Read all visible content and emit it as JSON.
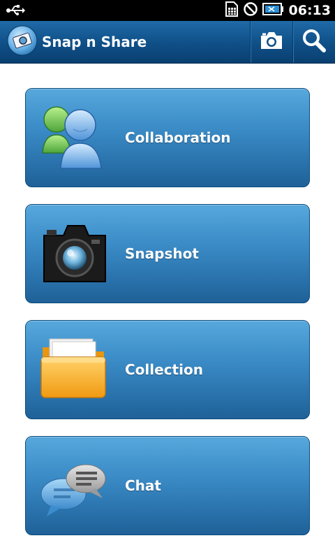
{
  "status_bar": {
    "time": "06:13",
    "icons": [
      "usb-icon",
      "sim-icon",
      "no-sign-icon",
      "battery-icon"
    ]
  },
  "app_bar": {
    "title": "Snap n Share",
    "actions": [
      "camera-icon",
      "search-icon"
    ]
  },
  "menu": {
    "items": [
      {
        "label": "Collaboration",
        "icon": "users-icon"
      },
      {
        "label": "Snapshot",
        "icon": "camera-icon"
      },
      {
        "label": "Collection",
        "icon": "folder-icon"
      },
      {
        "label": "Chat",
        "icon": "chat-icon"
      }
    ]
  },
  "colors": {
    "app_bar": "#0f4f87",
    "tile": "#3b8cc7",
    "status_bar": "#000000"
  }
}
